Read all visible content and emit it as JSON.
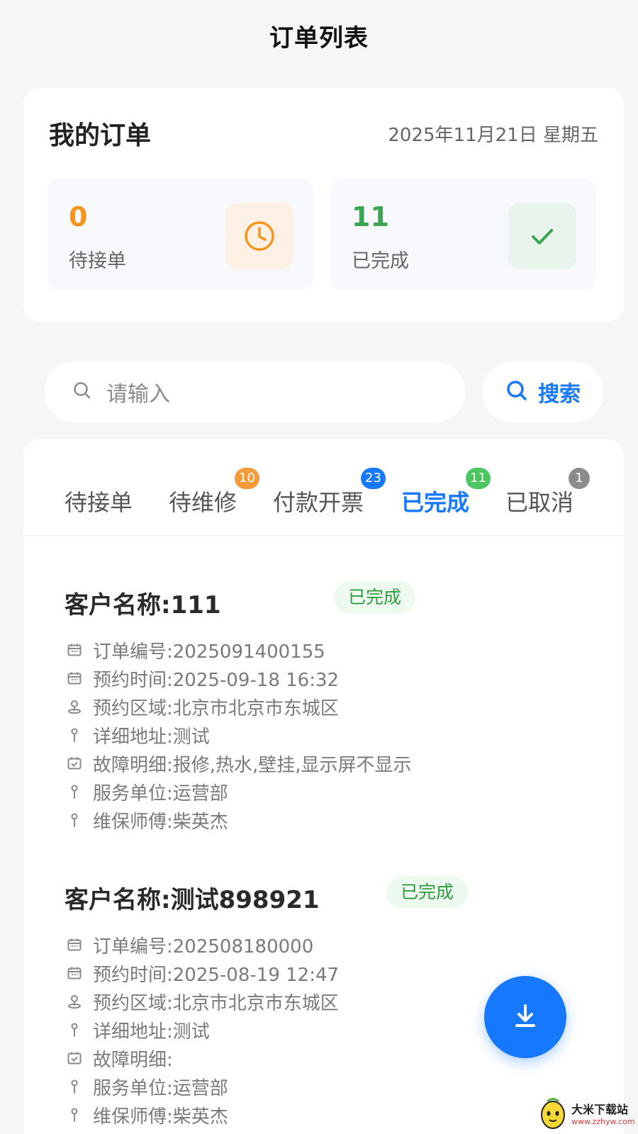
{
  "header": {
    "title": "订单列表"
  },
  "summary": {
    "title": "我的订单",
    "date": "2025年11月21日 星期五",
    "pending": {
      "count": "0",
      "label": "待接单",
      "icon": "clock-icon",
      "color": "#f7941d"
    },
    "completed": {
      "count": "11",
      "label": "已完成",
      "icon": "check-icon",
      "color": "#3aa651"
    }
  },
  "search": {
    "placeholder": "请输入",
    "button_label": "搜索"
  },
  "tabs": [
    {
      "label": "待接单",
      "badge": ""
    },
    {
      "label": "待维修",
      "badge": "10",
      "badge_color": "#f29b38"
    },
    {
      "label": "付款开票",
      "badge": "23",
      "badge_color": "#1677ff"
    },
    {
      "label": "已完成",
      "badge": "11",
      "badge_color": "#4cc760",
      "active": true
    },
    {
      "label": "已取消",
      "badge": "1",
      "badge_color": "#8c8c8c"
    }
  ],
  "orders": [
    {
      "name": "客户名称:111",
      "status": "已完成",
      "rows": [
        {
          "icon": "calendar-icon",
          "text": "订单编号:2025091400155"
        },
        {
          "icon": "calendar-icon",
          "text": "预约时间:2025-09-18 16:32"
        },
        {
          "icon": "location-icon",
          "text": "预约区域:北京市北京市东城区"
        },
        {
          "icon": "pin-icon",
          "text": "详细地址:测试"
        },
        {
          "icon": "calendar-check-icon",
          "text": "故障明细:报修,热水,壁挂,显示屏不显示"
        },
        {
          "icon": "pin-icon",
          "text": "服务单位:运营部"
        },
        {
          "icon": "pin-icon",
          "text": "维保师傅:柴英杰"
        }
      ]
    },
    {
      "name": "客户名称:测试898921",
      "status": "已完成",
      "rows": [
        {
          "icon": "calendar-icon",
          "text": "订单编号:202508180000"
        },
        {
          "icon": "calendar-icon",
          "text": "预约时间:2025-08-19 12:47"
        },
        {
          "icon": "location-icon",
          "text": "预约区域:北京市北京市东城区"
        },
        {
          "icon": "pin-icon",
          "text": "详细地址:测试"
        },
        {
          "icon": "calendar-check-icon",
          "text": "故障明细:"
        },
        {
          "icon": "pin-icon",
          "text": "服务单位:运营部"
        },
        {
          "icon": "pin-icon",
          "text": "维保师傅:柴英杰"
        }
      ]
    }
  ],
  "fab": {
    "icon": "download-icon"
  },
  "watermark": {
    "title": "大米下载站",
    "url": "www.zzhyw.com"
  }
}
